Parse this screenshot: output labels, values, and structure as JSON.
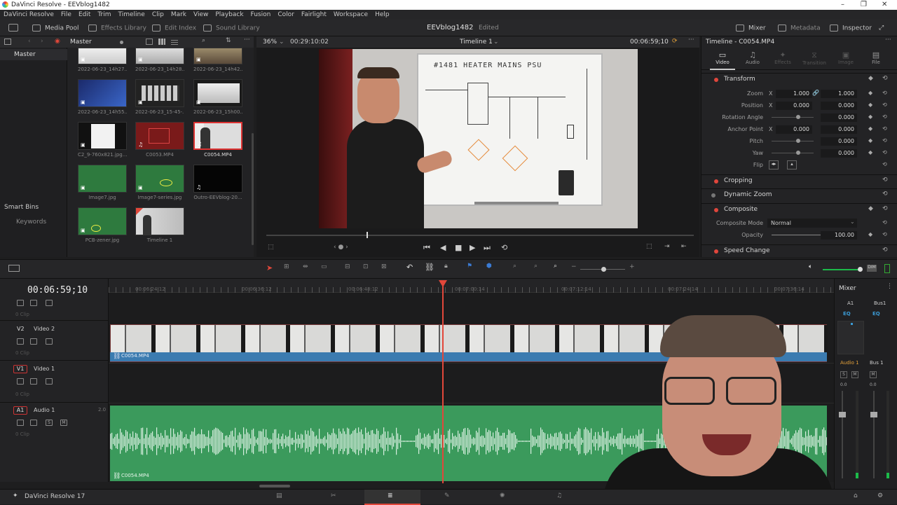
{
  "window": {
    "title": "DaVinci Resolve - EEVblog1482"
  },
  "menu": [
    "DaVinci Resolve",
    "File",
    "Edit",
    "Trim",
    "Timeline",
    "Clip",
    "Mark",
    "View",
    "Playback",
    "Fusion",
    "Color",
    "Fairlight",
    "Workspace",
    "Help"
  ],
  "toolbar": {
    "media_pool": "Media Pool",
    "effects_library": "Effects Library",
    "edit_index": "Edit Index",
    "sound_library": "Sound Library",
    "project_name": "EEVblog1482",
    "project_status": "Edited",
    "mixer": "Mixer",
    "metadata": "Metadata",
    "inspector": "Inspector"
  },
  "left_panel": {
    "master": "Master",
    "smart_bins": "Smart Bins",
    "keywords": "Keywords"
  },
  "media_pool": {
    "bin": "Master",
    "clips": [
      {
        "name": "2022-06-23_14h27..."
      },
      {
        "name": "2022-06-23_14h28..."
      },
      {
        "name": "2022-06-23_14h42..."
      },
      {
        "name": "2022-06-23_14h55..."
      },
      {
        "name": "2022-06-23_15-45-..."
      },
      {
        "name": "2022-06-23_15h00..."
      },
      {
        "name": "C2_9-760x821.jpg..."
      },
      {
        "name": "C0053.MP4"
      },
      {
        "name": "C0054.MP4"
      },
      {
        "name": "Image7.jpg"
      },
      {
        "name": "Image7-series.jpg"
      },
      {
        "name": "Outro-EEVblog-20..."
      },
      {
        "name": "PCB-zener.jpg"
      },
      {
        "name": "Timeline 1"
      }
    ]
  },
  "viewer": {
    "zoom": "36%",
    "duration": "00:29:10:02",
    "timeline_name": "Timeline 1",
    "timecode": "00:06:59;10",
    "whiteboard_title": "#1481  HEATER  MAINS  PSU"
  },
  "inspector": {
    "title": "Timeline - C0054.MP4",
    "tabs": [
      "Video",
      "Audio",
      "Effects",
      "Transition",
      "Image",
      "File"
    ],
    "sections": {
      "transform": "Transform",
      "cropping": "Cropping",
      "dynamic_zoom": "Dynamic Zoom",
      "composite": "Composite",
      "speed_change": "Speed Change"
    },
    "fields": {
      "zoom_label": "Zoom",
      "zoom_x": "1.000",
      "zoom_y": "1.000",
      "position_label": "Position",
      "position_x": "0.000",
      "position_y": "0.000",
      "rotation_label": "Rotation Angle",
      "rotation": "0.000",
      "anchor_label": "Anchor Point",
      "anchor_x": "0.000",
      "anchor_y": "0.000",
      "pitch_label": "Pitch",
      "pitch": "0.000",
      "yaw_label": "Yaw",
      "yaw": "0.000",
      "flip_label": "Flip",
      "composite_mode_label": "Composite Mode",
      "composite_mode": "Normal",
      "opacity_label": "Opacity",
      "opacity": "100.00",
      "x": "X",
      "y": "Y"
    }
  },
  "timeline": {
    "timecode": "00:06:59;10",
    "ruler": [
      "00:06:24:12",
      "00:06:36:12",
      "00:06:48:12",
      "00:07:00:14",
      "00:07:12:14",
      "00:07:24:14",
      "00:07:36:14"
    ],
    "tracks": [
      {
        "tag": "V2",
        "name": "Video 2"
      },
      {
        "tag": "V1",
        "name": "Video 1"
      },
      {
        "tag": "A1",
        "name": "Audio 1",
        "channel": "2.0"
      }
    ],
    "clip_count": "0 Clip",
    "video_clip": "C0054.MP4",
    "audio_clip": "C0054.MP4"
  },
  "mixer": {
    "title": "Mixer",
    "a1": "A1",
    "bus1": "Bus1",
    "eq": "EQ",
    "audio1": "Audio 1",
    "bus1_strip": "Bus 1",
    "level_a": "0.0",
    "level_b": "0.0"
  },
  "bottom": {
    "app_name": "DaVinci Resolve 17"
  }
}
